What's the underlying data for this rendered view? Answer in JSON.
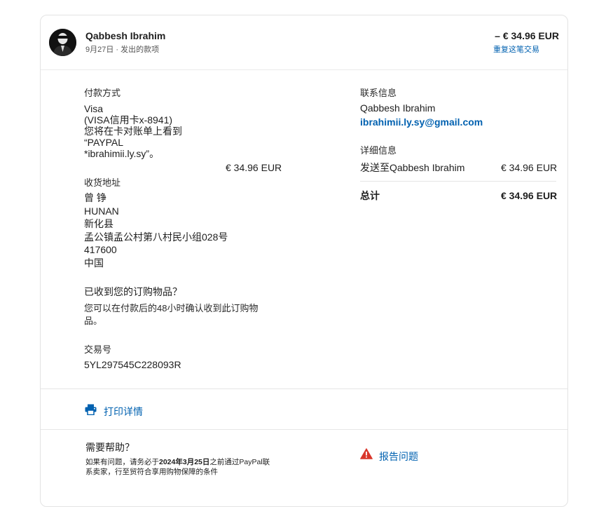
{
  "header": {
    "name": "Qabbesh Ibrahim",
    "subtitle": "9月27日 · 发出的款项",
    "amount": "– € 34.96 EUR",
    "repeat_link": "重复这笔交易"
  },
  "payment": {
    "label": "付款方式",
    "lines": [
      "Visa",
      "(VISA信用卡x-8941)",
      "您将在卡对账单上看到",
      "“PAYPAL",
      "*ibrahimii.ly.sy”。"
    ],
    "amount": "€ 34.96 EUR"
  },
  "shipping": {
    "label": "收货地址",
    "lines": [
      "曾 铮",
      "HUNAN",
      "新化县",
      "孟公镇孟公村第八村民小组028号",
      "417600",
      "中国"
    ]
  },
  "received": {
    "label": "已收到您的订购物品？",
    "lines": [
      "您可以在付款后的48小时确认收到此订购物",
      "品。"
    ]
  },
  "transaction": {
    "label": "交易号",
    "value": "5YL297545C228093R"
  },
  "contact": {
    "label": "联系信息",
    "name": "Qabbesh Ibrahim",
    "email": "ibrahimii.ly.sy@gmail.com"
  },
  "details": {
    "label": "详细信息",
    "item": "发送至Qabbesh Ibrahim",
    "item_amount": "€ 34.96 EUR",
    "total_label": "总计",
    "total_amount": "€ 34.96 EUR"
  },
  "print": {
    "label": "打印详情"
  },
  "help": {
    "title": "需要帮助？",
    "line1_prefix": "如果有问题，请务必于",
    "line1_date": "2024年3月25日",
    "line1_suffix": "之前通过PayPal联",
    "line2_visible": "系卖家，行至贸符合享用购物保障的条件"
  },
  "report": {
    "label": "报告问题"
  },
  "colors": {
    "link": "#0061b0",
    "warning": "#d9362b",
    "text": "#1e1e1e",
    "border": "#e3e3e3"
  }
}
